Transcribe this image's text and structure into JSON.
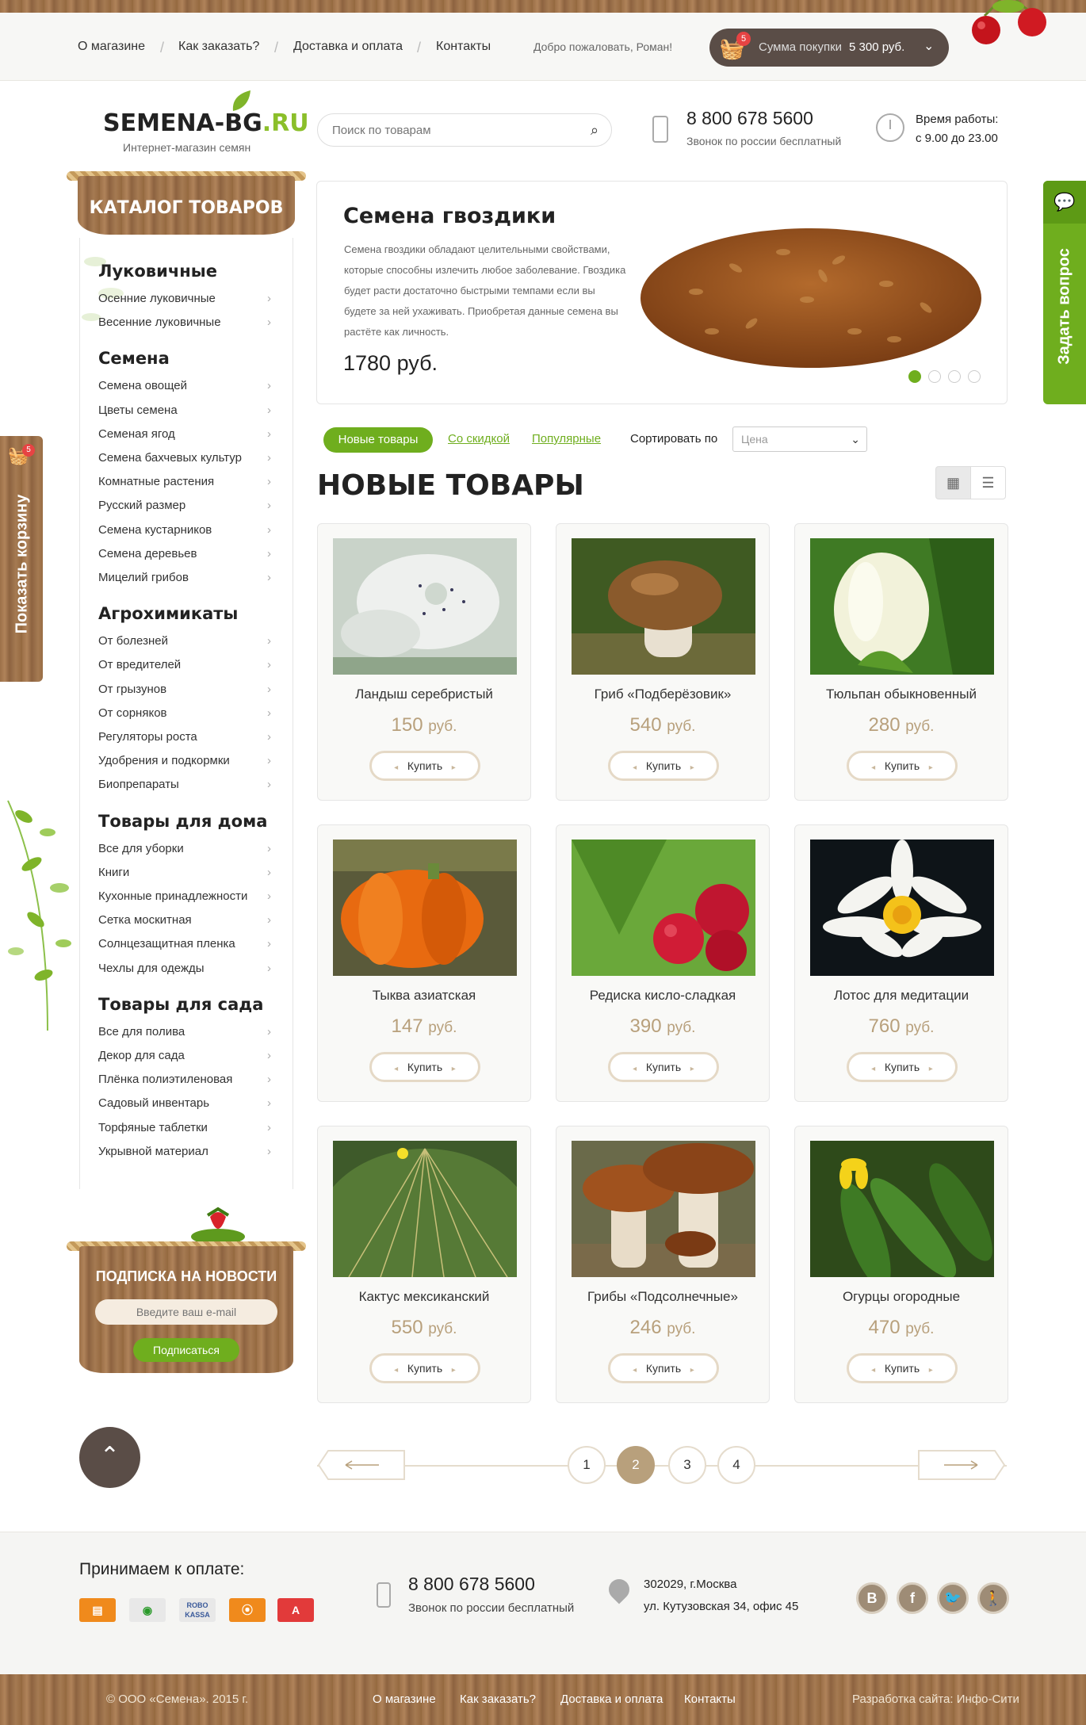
{
  "topnav": {
    "items": [
      "О магазине",
      "Как заказать?",
      "Доставка и оплата",
      "Контакты"
    ],
    "welcome": "Добро пожаловать, Роман!",
    "cart_badge": "5",
    "cart_label": "Сумма покупки",
    "cart_sum": "5 300 руб."
  },
  "header": {
    "logo_main": "SEMENA-BG",
    "logo_suffix": ".RU",
    "tagline": "Интернет-магазин семян",
    "search_placeholder": "Поиск по товарам",
    "phone": "8 800 678 5600",
    "phone_sub": "Звонок по россии бесплатный",
    "work_title": "Время работы:",
    "work_time": "с 9.00 до 23.00"
  },
  "catalog": {
    "title": "КАТАЛОГ ТОВАРОВ",
    "groups": [
      {
        "title": "Луковичные",
        "items": [
          "Осенние луковичные",
          "Весенние луковичные"
        ]
      },
      {
        "title": "Семена",
        "items": [
          "Семена овощей",
          "Цветы семена",
          "Семеная ягод",
          "Семена бахчевых культур",
          "Комнатные растения",
          "Русский размер",
          "Семена кустарников",
          "Семена деревьев",
          "Мицелий грибов"
        ]
      },
      {
        "title": "Агрохимикаты",
        "items": [
          "От болезней",
          "От вредителей",
          "От грызунов",
          "От сорняков",
          "Регуляторы роста",
          "Удобрения и подкормки",
          "Биопрепараты"
        ]
      },
      {
        "title": "Товары для дома",
        "items": [
          "Все для уборки",
          "Книги",
          "Кухонные принадлежности",
          "Сетка москитная",
          "Солнцезащитная пленка",
          "Чехлы для одежды"
        ]
      },
      {
        "title": "Товары для сада",
        "items": [
          "Все для полива",
          "Декор для сада",
          "Плёнка полиэтиленовая",
          "Садовый инвентарь",
          "Торфяные таблетки",
          "Укрывной материал"
        ]
      }
    ]
  },
  "subscribe": {
    "title": "ПОДПИСКА НА НОВОСТИ",
    "placeholder": "Введите ваш e-mail",
    "button": "Подписаться"
  },
  "side": {
    "cart_tab": "Показать корзину",
    "cart_badge": "5",
    "ask_tab": "Задать вопрос"
  },
  "slider": {
    "title": "Семена гвоздики",
    "text": "Семена гвоздики обладают целительными свойствами, которые способны излечить любое заболевание. Гвоздика будет расти достаточно быстрыми темпами если вы будете за ней ухаживать. Приобретая данные семена вы растёте как личность.",
    "price": "1780 руб.",
    "dots": 4,
    "active_dot": 1
  },
  "tabs": {
    "new": "Новые товары",
    "discount": "Со скидкой",
    "popular": "Популярные",
    "sort_label": "Сортировать по",
    "sort_value": "Цена"
  },
  "section_title": "НОВЫЕ ТОВАРЫ",
  "products": [
    {
      "name": "Ландыш серебристый",
      "price": "150",
      "img": "flower-white"
    },
    {
      "name": "Гриб «Подберёзовик»",
      "price": "540",
      "img": "mushroom"
    },
    {
      "name": "Тюльпан обыкновенный",
      "price": "280",
      "img": "tulip"
    },
    {
      "name": "Тыква азиатская",
      "price": "147",
      "img": "pumpkin"
    },
    {
      "name": "Редиска кисло-сладкая",
      "price": "390",
      "img": "radish"
    },
    {
      "name": "Лотос для медитации",
      "price": "760",
      "img": "lotus"
    },
    {
      "name": "Кактус мексиканский",
      "price": "550",
      "img": "cactus"
    },
    {
      "name": "Грибы «Подсолнечные»",
      "price": "246",
      "img": "mushrooms"
    },
    {
      "name": "Огурцы огородные",
      "price": "470",
      "img": "cucumber"
    }
  ],
  "price_unit": "руб.",
  "buy_label": "Купить",
  "pagination": {
    "pages": [
      "1",
      "2",
      "3",
      "4"
    ],
    "current": "2"
  },
  "footer": {
    "pay_title": "Принимаем к оплате:",
    "phone": "8 800 678 5600",
    "phone_sub": "Звонок по россии бесплатный",
    "addr1": "302029, г.Москва",
    "addr2": "ул. Кутузовская 34, офис 45",
    "social": [
      "В",
      "f",
      "t",
      "ok"
    ],
    "copyright": "© ООО «Семена». 2015 г.",
    "nav": [
      "О магазине",
      "Как заказать?",
      "Доставка и оплата",
      "Контакты"
    ],
    "developer": "Разработка сайта: Инфо-Сити"
  },
  "colors": {
    "accent": "#6fae1e",
    "brown": "#5a4d47",
    "price": "#b8a07c"
  }
}
